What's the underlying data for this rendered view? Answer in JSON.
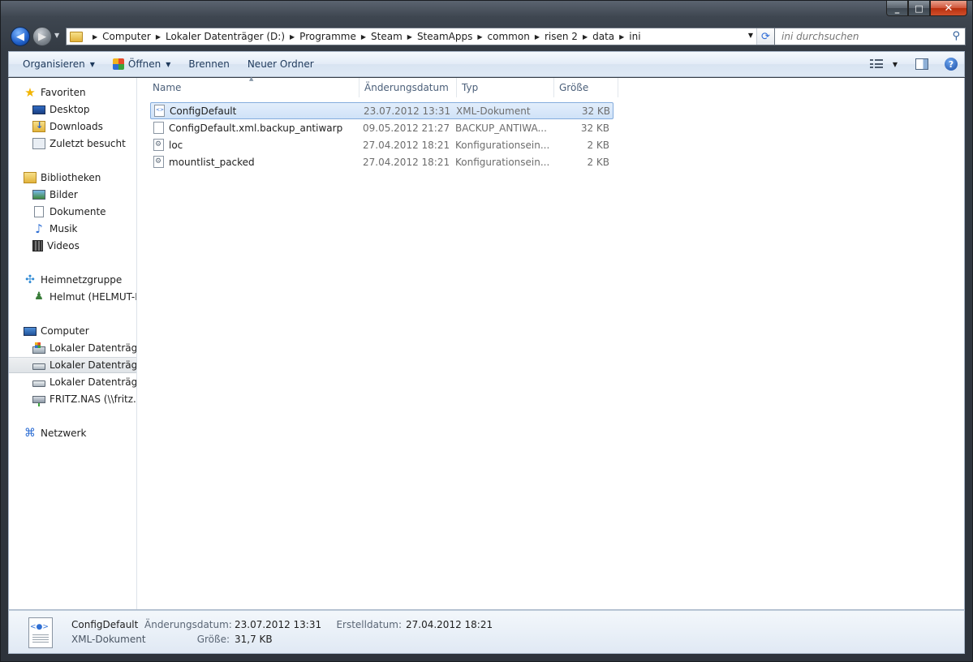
{
  "window": {
    "minimize": "_",
    "maximize": "□",
    "close": "✕"
  },
  "address": {
    "crumbs": [
      "Computer",
      "Lokaler Datenträger (D:)",
      "Programme",
      "Steam",
      "SteamApps",
      "common",
      "risen 2",
      "data",
      "ini"
    ],
    "search_placeholder": "ini durchsuchen"
  },
  "toolbar": {
    "organize": "Organisieren",
    "open": "Öffnen",
    "burn": "Brennen",
    "new_folder": "Neuer Ordner",
    "help": "?"
  },
  "navpane": {
    "favorites": "Favoriten",
    "desktop": "Desktop",
    "downloads": "Downloads",
    "recent": "Zuletzt besucht",
    "libraries": "Bibliotheken",
    "pictures": "Bilder",
    "documents": "Dokumente",
    "music": "Musik",
    "videos": "Videos",
    "homegroup": "Heimnetzgruppe",
    "user": "Helmut (HELMUT-P",
    "computer": "Computer",
    "drive1": "Lokaler Datenträger",
    "drive2": "Lokaler Datenträger",
    "drive3": "Lokaler Datenträger",
    "nas": "FRITZ.NAS (\\\\fritz.bo",
    "network": "Netzwerk"
  },
  "columns": {
    "name": "Name",
    "date": "Änderungsdatum",
    "type": "Typ",
    "size": "Größe"
  },
  "files": [
    {
      "name": "ConfigDefault",
      "date": "23.07.2012 13:31",
      "type": "XML-Dokument",
      "size": "32 KB",
      "icon": "xml-file-icon"
    },
    {
      "name": "ConfigDefault.xml.backup_antiwarp",
      "date": "09.05.2012 21:27",
      "type": "BACKUP_ANTIWA...",
      "size": "32 KB",
      "icon": "blank-file-icon"
    },
    {
      "name": "loc",
      "date": "27.04.2012 18:21",
      "type": "Konfigurationsein...",
      "size": "2 KB",
      "icon": "config-file-icon"
    },
    {
      "name": "mountlist_packed",
      "date": "27.04.2012 18:21",
      "type": "Konfigurationsein...",
      "size": "2 KB",
      "icon": "config-file-icon"
    }
  ],
  "details": {
    "name": "ConfigDefault",
    "type": "XML-Dokument",
    "modified_label": "Änderungsdatum:",
    "modified_value": "23.07.2012 13:31",
    "created_label": "Erstelldatum:",
    "created_value": "27.04.2012 18:21",
    "size_label": "Größe:",
    "size_value": "31,7 KB"
  }
}
